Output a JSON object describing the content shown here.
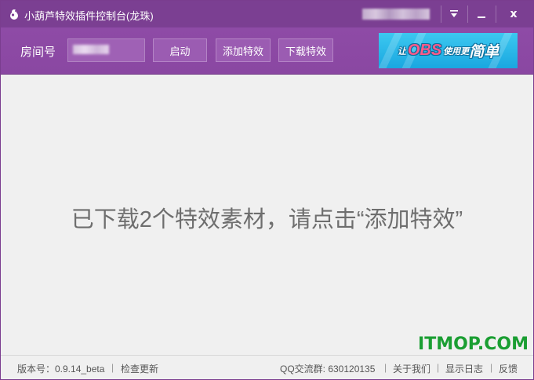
{
  "window": {
    "title": "小葫芦特效插件控制台(龙珠)"
  },
  "titlebar": {
    "buttons": [
      "dropdown",
      "minimize",
      "close"
    ],
    "close_glyph": "x"
  },
  "toolbar": {
    "room_label": "房间号",
    "room_input_value": "",
    "start_label": "启动",
    "add_effect_label": "添加特效",
    "download_effect_label": "下载特效",
    "banner": {
      "prefix": "让",
      "brand": "OBS",
      "middle": "使用更",
      "suffix": "简单"
    }
  },
  "main": {
    "message": "已下载2个特效素材，请点击“添加特效”"
  },
  "footer": {
    "version": "版本号：0.9.14_beta",
    "check_update": "检查更新",
    "qq_group": "QQ交流群: 630120135",
    "about": "关于我们",
    "show_log": "显示日志",
    "feedback": "反馈",
    "separator": "|"
  },
  "watermark": {
    "text": "ITMOP.COM"
  },
  "colors": {
    "titlebar": "#7b3f92",
    "toolbar": "#8e4ba6",
    "button": "#9b5cb2",
    "banner": "#1aa7e0",
    "message": "#6e6e6e",
    "watermark": "#1a9e32"
  }
}
